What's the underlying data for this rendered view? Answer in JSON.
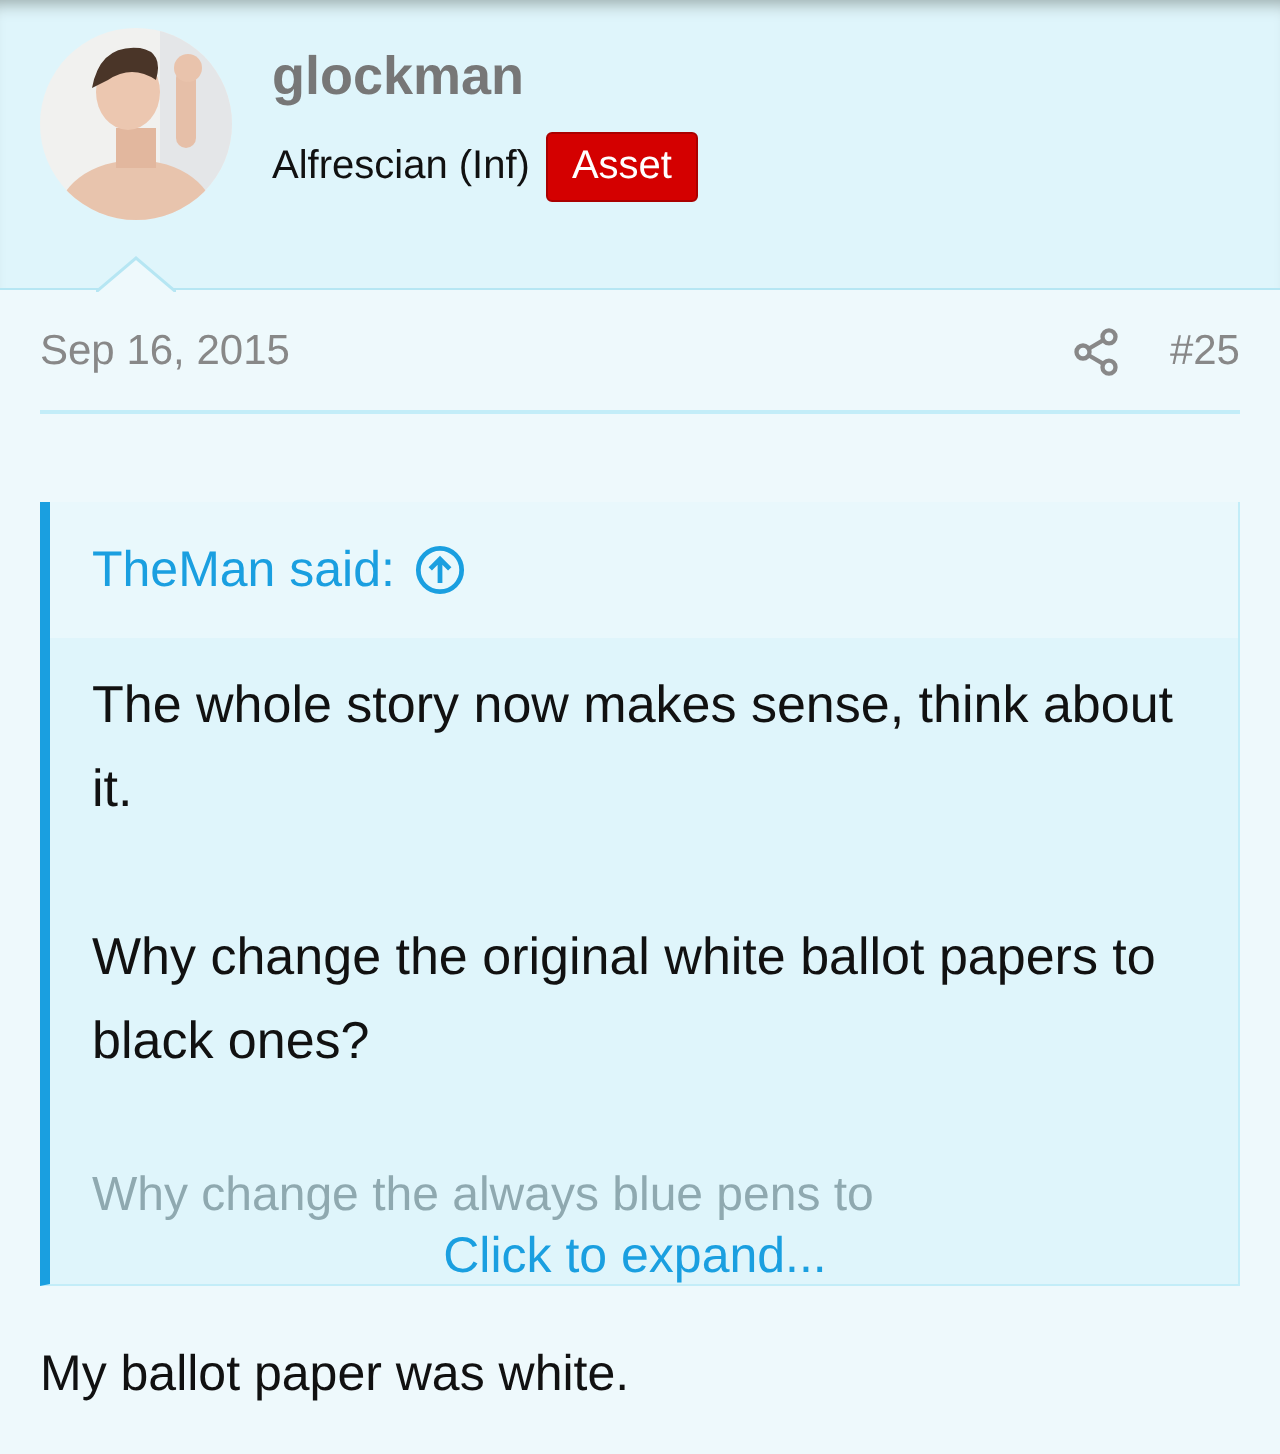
{
  "author": {
    "username": "glockman",
    "title": "Alfrescian (Inf)",
    "badge": "Asset"
  },
  "post": {
    "date": "Sep 16, 2015",
    "number": "#25",
    "quote": {
      "attribution": "TheMan said:",
      "paragraphs": [
        "The whole story now makes sense, think about it.",
        "Why change the original white ballot papers to black ones?"
      ],
      "faded_line": "Why change the always blue pens to",
      "expand": "Click to expand..."
    },
    "body": "My ballot paper was white."
  }
}
